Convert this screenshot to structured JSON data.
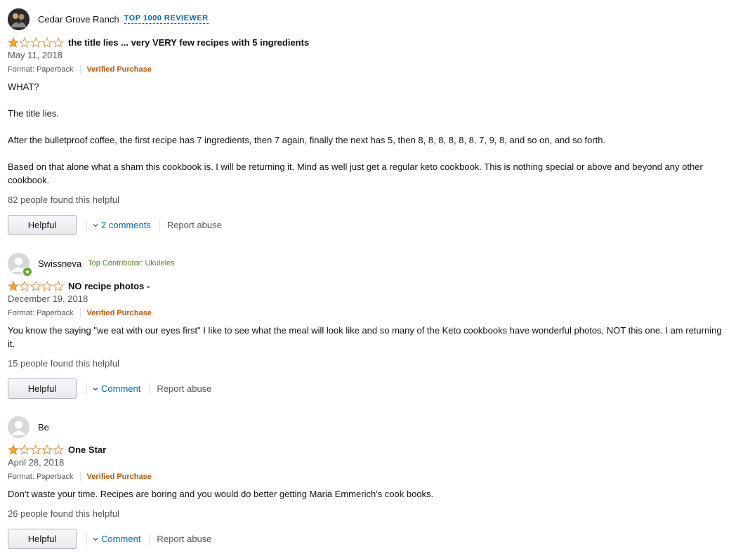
{
  "reviews": [
    {
      "name": "Cedar Grove Ranch",
      "badge": "TOP 1000 REVIEWER",
      "rating": 1,
      "title": "the title lies ... very VERY few recipes with 5 ingredients",
      "date": "May 11, 2018",
      "format": "Format: Paperback",
      "verified": "Verified Purchase",
      "body": [
        "WHAT?",
        "The title lies.",
        "After the bulletproof coffee, the first recipe has 7 ingredients, then 7 again, finally the next has 5, then 8, 8, 8, 8, 8, 8, 7, 9, 8, and so on, and so forth.",
        "Based on that alone what a sham this cookbook is. I will be returning it. Mind as well just get a regular keto cookbook. This is nothing special or above and beyond any other cookbook."
      ],
      "helpful_count": "82 people found this helpful",
      "helpful_label": "Helpful",
      "comments_label": "2 comments",
      "report_label": "Report abuse"
    },
    {
      "name": "Swissneva",
      "badge": "Top Contributor: Ukuleles",
      "rating": 1,
      "title": "NO recipe photos -",
      "date": "December 19, 2018",
      "format": "Format: Paperback",
      "verified": "Verified Purchase",
      "body": [
        "You know the saying \"we eat with our eyes first\" I like to see what the meal will look like and so many of the Keto cookbooks have wonderful photos, NOT this one. I am returning it."
      ],
      "helpful_count": "15 people found this helpful",
      "helpful_label": "Helpful",
      "comments_label": "Comment",
      "report_label": "Report abuse"
    },
    {
      "name": "Be",
      "badge": "",
      "rating": 1,
      "title": "One Star",
      "date": "April 28, 2018",
      "format": "Format: Paperback",
      "verified": "Verified Purchase",
      "body": [
        "Don't waste your time. Recipes are boring and you would do better getting Maria Emmerich's cook books."
      ],
      "helpful_count": "26 people found this helpful",
      "helpful_label": "Helpful",
      "comments_label": "Comment",
      "report_label": "Report abuse"
    }
  ],
  "colors": {
    "star_fill": "#ffa41c",
    "star_outline": "#de7921",
    "link": "#0066c0",
    "verified": "#c45500",
    "contributor": "#55841c"
  }
}
